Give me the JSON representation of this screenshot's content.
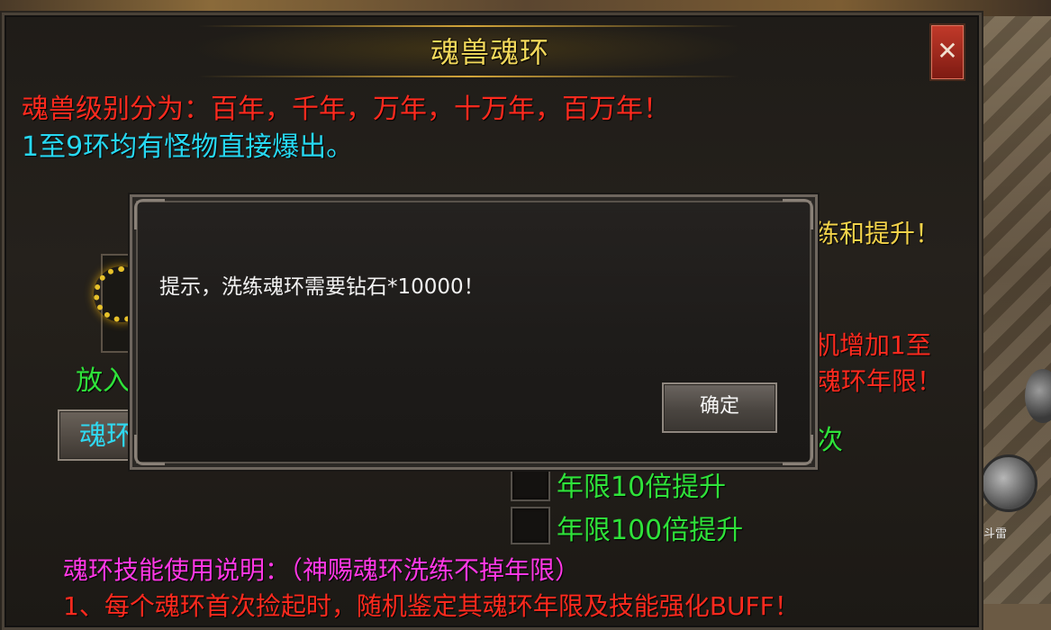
{
  "window": {
    "title": "魂兽魂环",
    "close_label": "✕"
  },
  "info": {
    "level_line": "魂兽级别分为：百年，千年，万年，十万年，百万年！",
    "drop_line": "1至9环均有怪物直接爆出。",
    "right_upgrade": "练和提升！",
    "right_increase": "机增加1至",
    "right_years": "魂环年限！",
    "right_times": "次"
  },
  "left_panel": {
    "place_label": "放入",
    "action_button": "魂环"
  },
  "options": [
    {
      "label": "年限10倍提升"
    },
    {
      "label": "年限100倍提升"
    }
  ],
  "skill_section": {
    "title": "魂环技能使用说明：（神赐魂环洗练不掉年限）",
    "bottom_line": "1、每个魂环首次捡起时，随机鉴定其魂环年限及技能强化BUFF！"
  },
  "dialog": {
    "message": "提示，洗练魂环需要钻石*10000！",
    "confirm_label": "确定"
  },
  "map": {
    "label": "斗雷"
  },
  "colors": {
    "title": "#f3d95b",
    "red_text": "#ff2a1e",
    "cyan_text": "#27d8f2",
    "green_text": "#2fe23a",
    "magenta_text": "#ff38e5",
    "yellow_text": "#f2d24a"
  },
  "icons": [
    "close-icon",
    "soul-ring-icon",
    "minimap-icon"
  ]
}
